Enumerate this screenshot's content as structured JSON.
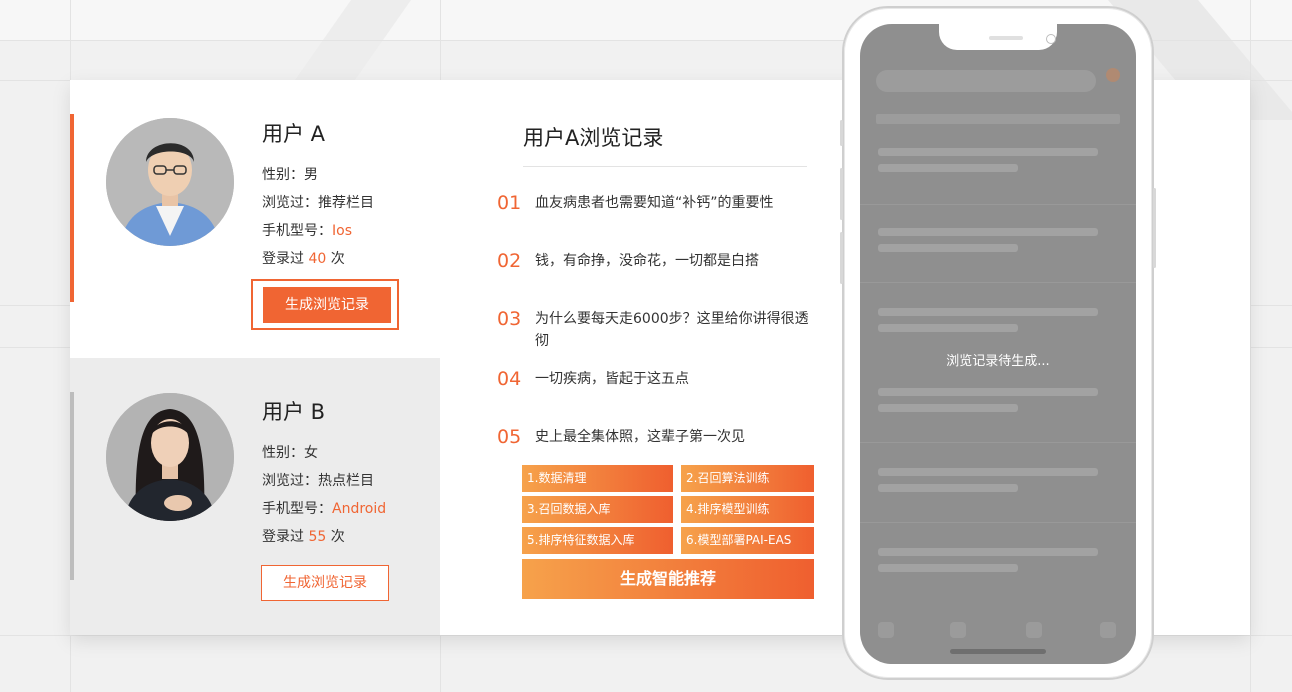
{
  "user_a": {
    "name": "用户 A",
    "gender_label": "性别：",
    "gender": "男",
    "browsed_label": "浏览过：",
    "browsed": "推荐栏目",
    "phone_label": "手机型号：",
    "phone": "Ios",
    "login_prefix": "登录过",
    "login_count": "40",
    "login_suffix": "次",
    "button": "生成浏览记录"
  },
  "user_b": {
    "name": "用户 B",
    "gender_label": "性别：",
    "gender": "女",
    "browsed_label": "浏览过：",
    "browsed": "热点栏目",
    "phone_label": "手机型号：",
    "phone": "Android",
    "login_prefix": "登录过",
    "login_count": "55",
    "login_suffix": "次",
    "button": "生成浏览记录"
  },
  "history": {
    "title": "用户A浏览记录",
    "items": [
      {
        "num": "01",
        "text": "血友病患者也需要知道“补钙”的重要性"
      },
      {
        "num": "02",
        "text": "钱，有命挣，没命花，一切都是白搭"
      },
      {
        "num": "03",
        "text": "为什么要每天走6000步？这里给你讲得很透彻"
      },
      {
        "num": "04",
        "text": "一切疾病，皆起于这五点"
      },
      {
        "num": "05",
        "text": "史上最全集体照，这辈子第一次见"
      }
    ]
  },
  "pipeline": {
    "steps": [
      "1.数据清理",
      "2.召回算法训练",
      "3.召回数据入库",
      "4.排序模型训练",
      "5.排序特征数据入库",
      "6.模型部署PAI-EAS"
    ],
    "generate_button": "生成智能推荐"
  },
  "phone": {
    "screen_message": "浏览记录待生成..."
  },
  "colors": {
    "accent": "#f06533",
    "gradient_start": "#f6a24b",
    "gradient_end": "#ef5f2f"
  }
}
